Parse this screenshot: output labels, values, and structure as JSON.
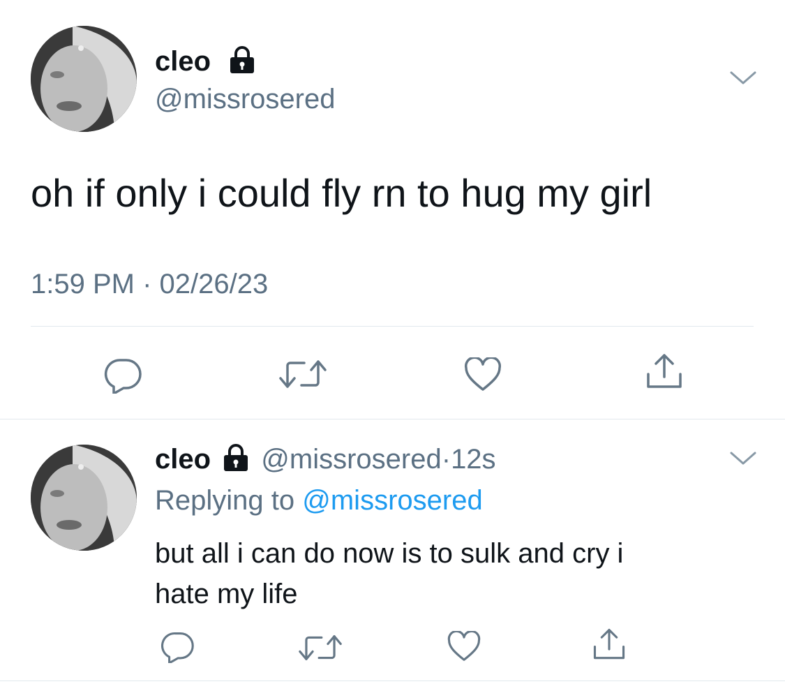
{
  "tweet": {
    "display_name": "cleo",
    "handle": "@missrosered",
    "text": "oh if only i could fly rn to hug my girl",
    "time": "1:59 PM",
    "separator": "·",
    "date": "02/26/23",
    "icons": [
      "lock-icon",
      "chevron-down-icon",
      "reply-icon",
      "retweet-icon",
      "like-icon",
      "share-icon"
    ]
  },
  "reply": {
    "display_name": "cleo",
    "handle": "@missrosered",
    "separator": "·",
    "age": "12s",
    "replying_prefix": "Replying to",
    "replying_handle": "@missrosered",
    "text_line1": "but all i can do now is to sulk and cry i",
    "text_line2": "hate my life"
  },
  "colors": {
    "text": "#0f1419",
    "muted": "#5b7083",
    "link": "#1d9bf0",
    "divider": "#e1e8ed"
  }
}
